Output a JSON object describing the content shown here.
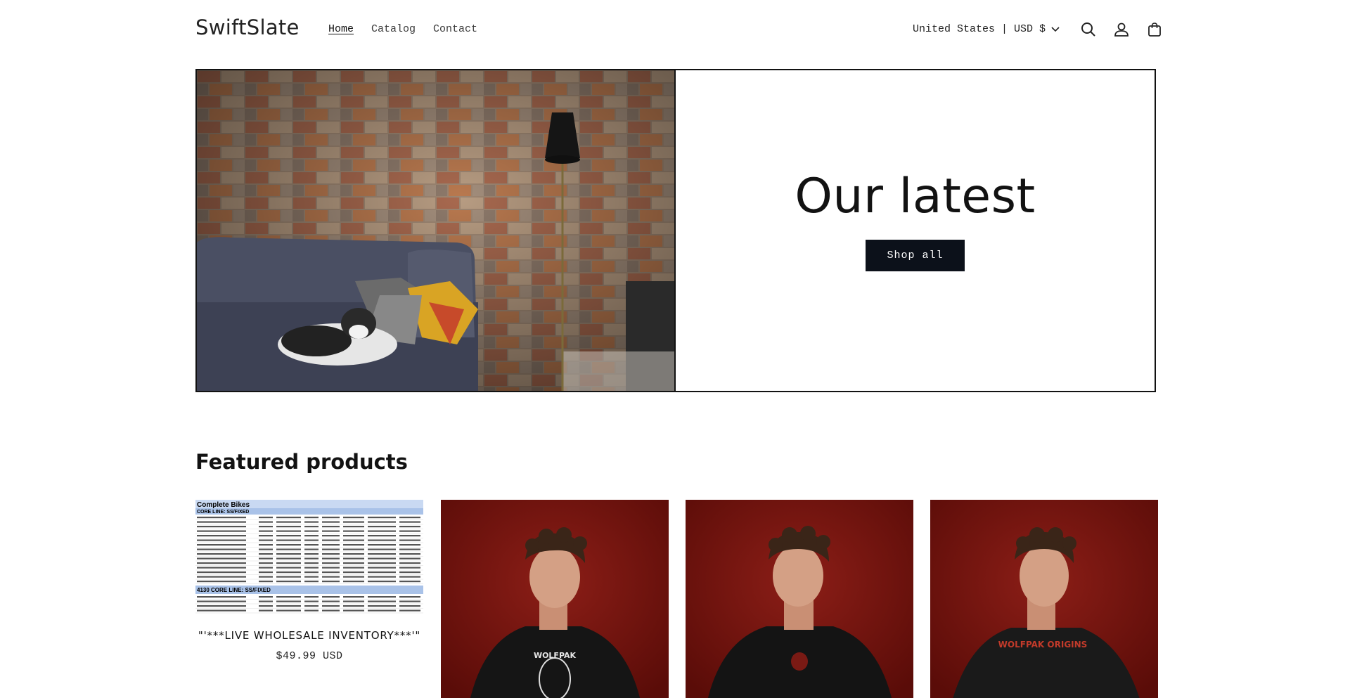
{
  "header": {
    "logo": "SwiftSlate",
    "nav": [
      {
        "label": "Home",
        "active": true
      },
      {
        "label": "Catalog",
        "active": false
      },
      {
        "label": "Contact",
        "active": false
      }
    ],
    "currency": "United States | USD $",
    "icons": [
      "chevron-down-icon",
      "search-icon",
      "account-icon",
      "cart-icon"
    ]
  },
  "hero": {
    "title": "Our latest",
    "button_label": "Shop all"
  },
  "featured": {
    "title": "Featured products",
    "products": [
      {
        "title": "\"'***LIVE WHOLESALE INVENTORY***'\"",
        "price": "$49.99 USD"
      },
      {
        "title": "",
        "price": ""
      },
      {
        "title": "",
        "price": ""
      },
      {
        "title": "",
        "price": ""
      }
    ],
    "spreadsheet": {
      "heading": "Complete Bikes",
      "section_label": "CORE LINE: SS/FIXED",
      "section_label_2": "4130 CORE LINE: SS/FIXED",
      "columns": [
        "Product Title/Model Name",
        "Inventory Qty",
        "Brand",
        "Model ID/MPN",
        "Category",
        "QTY/UPC/MSRP"
      ]
    },
    "shirt_prints": [
      "WOLFPAK",
      "WOLFPAK ORIGINS"
    ]
  },
  "colors": {
    "button_bg": "#0c111a",
    "text": "#121212",
    "product_bg": "#7a1410"
  }
}
